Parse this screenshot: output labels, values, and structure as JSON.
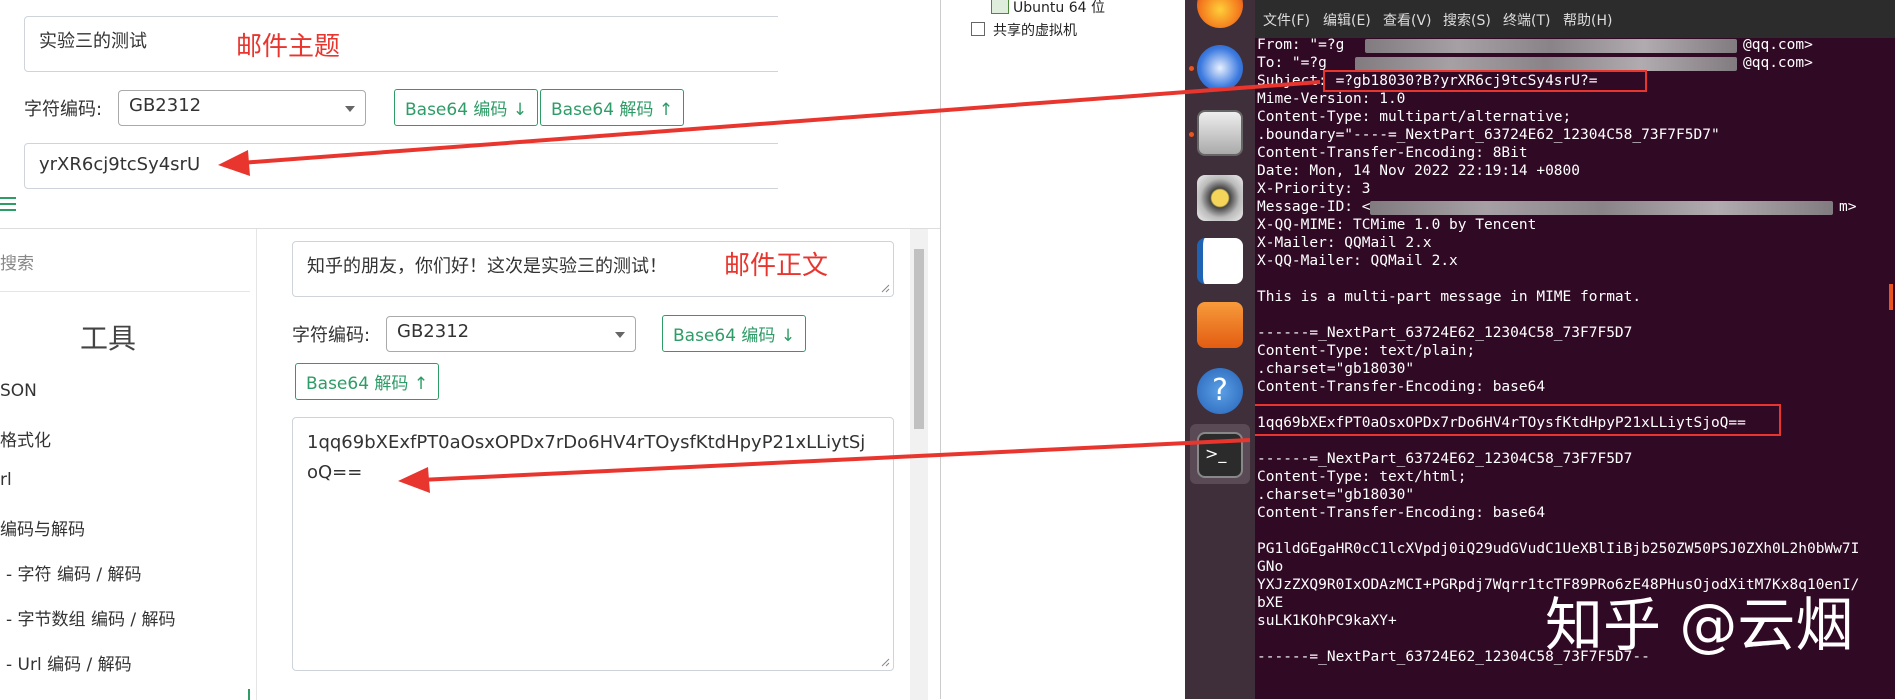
{
  "top_panel": {
    "subject_value": "实验三的测试",
    "subject_note": "邮件主题",
    "charset_label": "字符编码:",
    "charset_value": "GB2312",
    "encode_button": "Base64 编码 ↓",
    "decode_button": "Base64 解码 ↑",
    "encoded_value": "yrXR6cj9tcSy4srU"
  },
  "bottom_panel": {
    "search_placeholder": "搜索",
    "tools_heading": "工具",
    "sidebar_items": [
      "SON",
      "格式化",
      "rl",
      "编码与解码",
      "- 字符 编码 / 解码",
      "- 字节数组 编码 / 解码",
      "- Url 编码 / 解码"
    ],
    "body_value": "知乎的朋友，你们好！这次是实验三的测试！",
    "body_note": "邮件正文",
    "charset_label": "字符编码:",
    "charset_value": "GB2312",
    "encode_button": "Base64 编码 ↓",
    "decode_button": "Base64 解码 ↑",
    "encoded_line1": "1qq69bXExfPT0aOsxOPDx7rDo6HV4rTOysfKtdHpyP21xLLiytSj",
    "encoded_line2": "oQ=="
  },
  "vm_panel": {
    "item_ubuntu": "Ubuntu 64 位",
    "item_shared": "共享的虚拟机"
  },
  "dock": {
    "icons": [
      "firefox-icon",
      "thunderbird-icon",
      "files-icon",
      "rhythmbox-icon",
      "writer-icon",
      "software-center-icon",
      "help-icon",
      "terminal-icon"
    ]
  },
  "terminal": {
    "menu": [
      "文件(F)",
      "编辑(E)",
      "查看(V)",
      "搜索(S)",
      "终端(T)",
      "帮助(H)"
    ],
    "lines": [
      "From: \"=?g",
      "To: \"=?g",
      "Subject: =?gb18030?B?yrXR6cj9tcSy4srU?=",
      "Mime-Version: 1.0",
      "Content-Type: multipart/alternative;",
      ".boundary=\"----=_NextPart_63724E62_12304C58_73F7F5D7\"",
      "Content-Transfer-Encoding: 8Bit",
      "Date: Mon, 14 Nov 2022 22:19:14 +0800",
      "X-Priority: 3",
      "Message-ID: <",
      "X-QQ-MIME: TCMime 1.0 by Tencent",
      "X-Mailer: QQMail 2.x",
      "X-QQ-Mailer: QQMail 2.x",
      "",
      "This is a multi-part message in MIME format.",
      "",
      "------=_NextPart_63724E62_12304C58_73F7F5D7",
      "Content-Type: text/plain;",
      ".charset=\"gb18030\"",
      "Content-Transfer-Encoding: base64",
      "",
      "1qq69bXExfPT0aOsxOPDx7rDo6HV4rTOysfKtdHpyP21xLLiytSjoQ==",
      "",
      "------=_NextPart_63724E62_12304C58_73F7F5D7",
      "Content-Type: text/html;",
      ".charset=\"gb18030\"",
      "Content-Transfer-Encoding: base64",
      "",
      "PG1ldGEgaHR0cC1lcXVpdj0iQ29udGVudC1UeXBlIiBjb250ZW50PSJ0ZXh0L2h0bWw7I",
      "GNo",
      "YXJzZXQ9R0IxODAzMCI+PGRpdj7Wqrr1tcTF89PRo6zE48PHusOjodXitM7Kx8q10enI/",
      "bXE",
      "suLK1KOhPC9kaXY+",
      "",
      "------=_NextPart_63724E62_12304C58_73F7F5D7--"
    ],
    "from_tail": "@qq.com>",
    "to_tail": "@qq.com>",
    "msgid_tail": "m>",
    "watermark": "知乎 @云烟"
  },
  "colors": {
    "annotation_red": "#e8362f",
    "button_green": "#2e9c66",
    "terminal_bg": "#300a24",
    "dock_bg": "#3f2f3a"
  }
}
